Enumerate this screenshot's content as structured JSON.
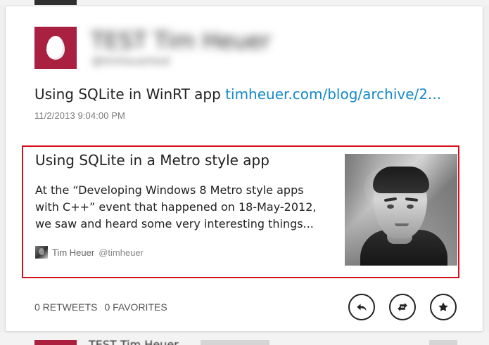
{
  "background": {
    "bottom_user_fragment": "TEST Tim Heuer"
  },
  "tweet": {
    "author_name": "TEST Tim Heuer",
    "author_handle": "@timheuertest",
    "text_prefix": "Using SQLite in WinRT app",
    "link_text": "timheuer.com/blog/archive/2...",
    "timestamp": "11/2/2013 9:04:00 PM"
  },
  "preview": {
    "title": "Using SQLite in a Metro style app",
    "description": "At the “Developing Windows 8 Metro style apps with C++” event that happened on 18-May-2012, we saw and heard some very interesting things...",
    "author_name": "Tim Heuer",
    "author_handle": "@timheuer"
  },
  "stats": {
    "retweets_label": "0 RETWEETS",
    "favorites_label": "0 FAVORITES"
  },
  "icons": {
    "reply": "reply-icon",
    "retweet": "retweet-icon",
    "favorite": "star-icon"
  },
  "colors": {
    "link": "#1589c7",
    "highlight_border": "#d50f1c",
    "avatar": "#a92040"
  }
}
